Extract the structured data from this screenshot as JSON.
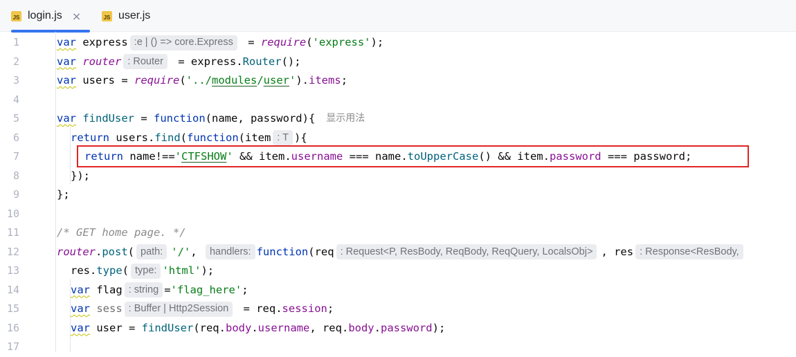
{
  "tabs": [
    {
      "label": "login.js",
      "badge": "JS",
      "close": "×"
    },
    {
      "label": "user.js",
      "badge": "JS"
    }
  ],
  "line_numbers": [
    "1",
    "2",
    "3",
    "4",
    "5",
    "6",
    "7",
    "8",
    "9",
    "10",
    "11",
    "12",
    "13",
    "14",
    "15",
    "16",
    "17"
  ],
  "code": {
    "l1": {
      "kw": "var",
      "name": "express",
      "hint": ":e | () => core.Express",
      "rest1": " = ",
      "req": "require",
      "p1": "(",
      "str": "'express'",
      "p2": ");"
    },
    "l2": {
      "kw": "var",
      "name": "router",
      "hint": ": Router",
      "rest1": " = express.",
      "cls": "Router",
      "p2": "();"
    },
    "l3": {
      "kw": "var",
      "rest1": " users = ",
      "req": "require",
      "p1": "(",
      "s1": "'../",
      "s2": "modules",
      "s3": "/",
      "s4": "user",
      "s5": "'",
      "p2": ").",
      "field": "items",
      "p3": ";"
    },
    "l5": {
      "kw": "var",
      "name": "findUser",
      "rest1": " = ",
      "fkw": "function",
      "params": "(name, password){",
      "usage": "显示用法"
    },
    "l6": {
      "kw": "return",
      "rest1": " users.",
      "method": "find",
      "p1": "(",
      "fkw": "function",
      "p2": "(item",
      "hint": ": T",
      "p3": "){"
    },
    "l7": {
      "kw": "return",
      "rest1": " name!==",
      "s1": "'",
      "s2": "CTFSHOW",
      "s3": "'",
      "rest2": " && item.",
      "f1": "username",
      "rest3": " === name.",
      "m1": "toUpperCase",
      "rest4": "() && item.",
      "f2": "password",
      "rest5": " === password;"
    },
    "l8": {
      "text": "});"
    },
    "l9": {
      "text": "};"
    },
    "l11": {
      "text": "/* GET home page. */"
    },
    "l12": {
      "router": "router",
      "dot": ".",
      "post": "post",
      "p1": "(",
      "h1": "path:",
      "s1": "'/'",
      "p2": ", ",
      "h2": "handlers:",
      "fkw": "function",
      "p3": "(req",
      "h3": ": Request<P, ResBody, ReqBody, ReqQuery, LocalsObj>",
      "p4": ", res",
      "h4": ": Response<ResBody,"
    },
    "l13": {
      "pre": "res.",
      "method": "type",
      "p1": "(",
      "h1": "type:",
      "str": "'html'",
      "p2": ");"
    },
    "l14": {
      "kw": "var",
      "name": "flag",
      "hint": ": string",
      "p1": "=",
      "str": "'flag_here'",
      "p2": ";"
    },
    "l15": {
      "kw": "var",
      "name": "sess",
      "hint": ": Buffer | Http2Session",
      "rest1": " = req.",
      "field": "session",
      "p2": ";"
    },
    "l16": {
      "kw": "var",
      "rest1": " user = ",
      "fn": "findUser",
      "p1": "(req.",
      "f1": "body",
      "p2": ".",
      "f2": "username",
      "p3": ", req.",
      "f3": "body",
      "p4": ".",
      "f4": "password",
      "p5": ");"
    }
  }
}
